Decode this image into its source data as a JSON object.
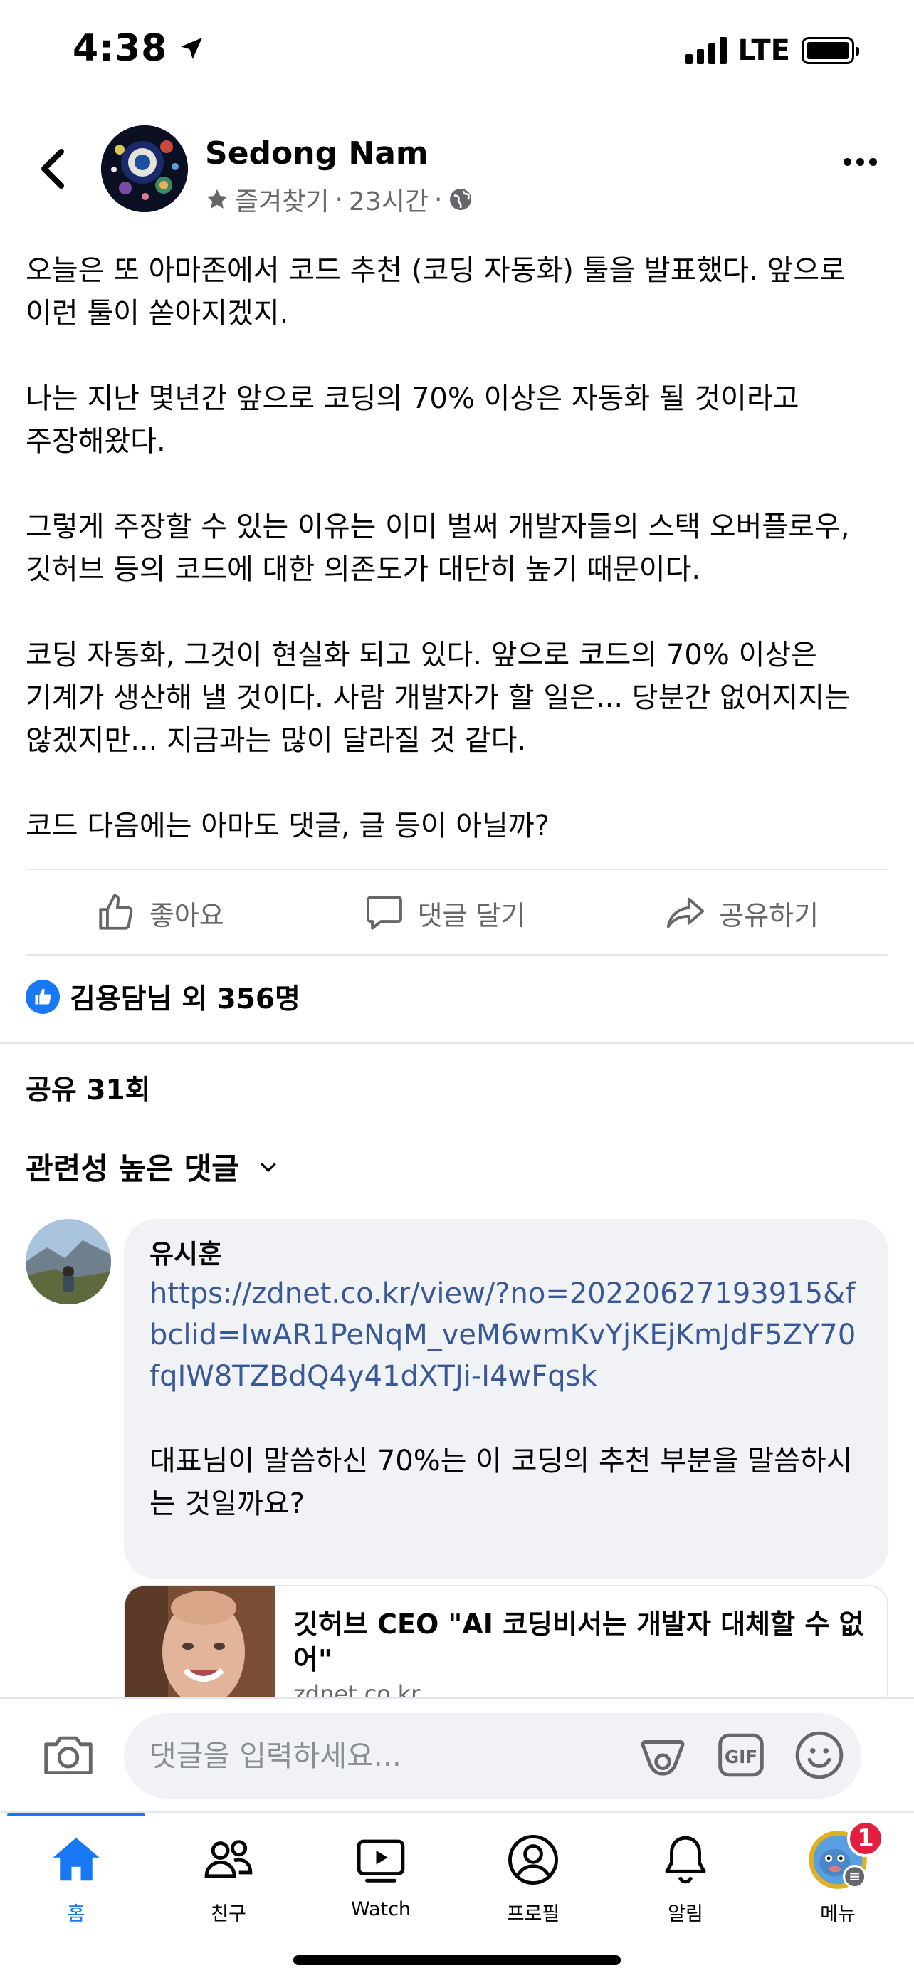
{
  "status_bar": {
    "time": "4:38",
    "network": "LTE"
  },
  "post": {
    "author": "Sedong Nam",
    "meta_favorite": "즐겨찾기",
    "meta_sep": "·",
    "meta_time": "23시간",
    "meta_sep2": "·",
    "body": "오늘은 또 아마존에서 코드 추천 (코딩 자동화) 툴을 발표했다. 앞으로 이런 툴이 쏟아지겠지.\n\n나는 지난 몇년간 앞으로 코딩의 70% 이상은 자동화 될 것이라고 주장해왔다.\n\n그렇게 주장할 수 있는 이유는 이미 벌써 개발자들의 스택 오버플로우, 깃허브 등의 코드에 대한 의존도가 대단히 높기 때문이다.\n\n코딩 자동화, 그것이 현실화 되고 있다. 앞으로 코드의 70% 이상은 기계가 생산해 낼 것이다. 사람 개발자가 할 일은... 당분간 없어지지는 않겠지만... 지금과는 많이 달라질 것 같다.\n\n코드 다음에는 아마도 댓글, 글 등이 아닐까?"
  },
  "actions": {
    "like": "좋아요",
    "comment": "댓글 달기",
    "share": "공유하기"
  },
  "reactions_text": "김용담님 외 356명",
  "shares_text": "공유 31회",
  "comment_filter": "관련성 높은 댓글",
  "comment": {
    "author": "유시훈",
    "link": "https://zdnet.co.kr/view/?no=20220627193915&fbclid=IwAR1PeNqM_veM6wmKvYjKEjKmJdF5ZY70fqIW8TZBdQ4y41dXTJi-I4wFqsk",
    "text": "대표님이 말씀하신 70%는 이 코딩의 추천 부분을 말씀하시는 것일까요?"
  },
  "link_card": {
    "title": "깃허브 CEO \"AI 코딩비서는 개발자 대체할 수 없어\"",
    "domain": "zdnet.co.kr"
  },
  "composer": {
    "placeholder": "댓글을 입력하세요..."
  },
  "tabs": [
    {
      "label": "홈",
      "icon": "home-icon"
    },
    {
      "label": "친구",
      "icon": "friends-icon"
    },
    {
      "label": "Watch",
      "icon": "watch-icon"
    },
    {
      "label": "프로필",
      "icon": "profile-icon"
    },
    {
      "label": "알림",
      "icon": "bell-icon"
    },
    {
      "label": "메뉴",
      "icon": "menu-avatar-icon"
    }
  ],
  "menu_badge": "1",
  "colors": {
    "accent": "#1877f2",
    "link": "#385898",
    "secondary_text": "#65676b",
    "badge": "#e41e3f"
  }
}
